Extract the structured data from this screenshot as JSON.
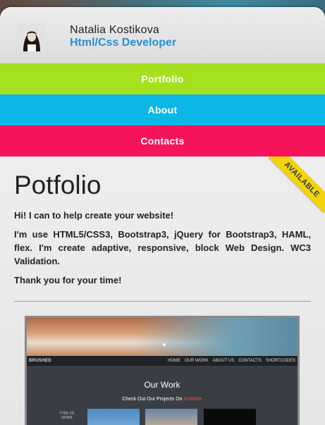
{
  "profile": {
    "name": "Natalia Kostikova",
    "role": "Html/Css Developer"
  },
  "nav": {
    "portfolio": "Portfolio",
    "about": "About",
    "contacts": "Contacts"
  },
  "badge": "AVAILABLE",
  "main": {
    "title": "Potfolio",
    "paragraphs": [
      "Hi! I can to help create your website!",
      "I'm use HTML5/CSS3, Bootstrap3, jQuery for Bootstrap3, HAML, flex. I'm create adaptive, responsive, block Web Design. WC3 Validation.",
      "Thank you for your time!"
    ]
  },
  "preview": {
    "brand": "BRUSHED",
    "nav_links": [
      "HOME",
      "OUR WORK",
      "ABOUT US",
      "CONTACTS",
      "SHORTCODES"
    ],
    "heading": "Our Work",
    "subheading_prefix": "Check Out Our Projects On",
    "subheading_link": "Dribbble",
    "type_of_work": "TYPE OF WORK"
  },
  "colors": {
    "portfolio": "#a6e11f",
    "about": "#0ab7e6",
    "contacts": "#f5145a",
    "role": "#2a8fd6",
    "badge": "#f1d40b"
  }
}
